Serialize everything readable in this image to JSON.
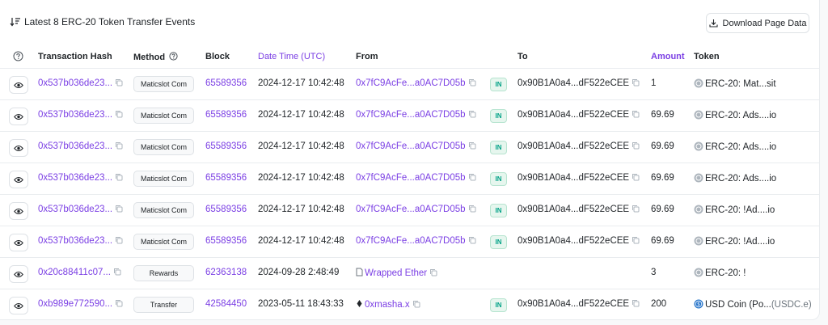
{
  "header": {
    "title": "Latest 8 ERC-20 Token Transfer Events",
    "download_label": "Download Page Data"
  },
  "columns": {
    "tx_hash": "Transaction Hash",
    "method": "Method",
    "block": "Block",
    "datetime": "Date Time (UTC)",
    "from": "From",
    "to": "To",
    "amount": "Amount",
    "token": "Token"
  },
  "rows": [
    {
      "hash": "0x537b036de23...",
      "method": "Maticslot Com",
      "block": "65589356",
      "time": "2024-12-17 10:42:48",
      "from": "0x7fC9AcFe...a0AC7D05b",
      "from_type": "address",
      "direction": "IN",
      "to": "0x90B1A0a4...dF522eCEE",
      "amount": "1",
      "token": "ERC-20: Mat...sit",
      "token_extra": "",
      "token_icon": "token-generic-icon"
    },
    {
      "hash": "0x537b036de23...",
      "method": "Maticslot Com",
      "block": "65589356",
      "time": "2024-12-17 10:42:48",
      "from": "0x7fC9AcFe...a0AC7D05b",
      "from_type": "address",
      "direction": "IN",
      "to": "0x90B1A0a4...dF522eCEE",
      "amount": "69.69",
      "token": "ERC-20: Ads....io",
      "token_extra": "",
      "token_icon": "token-generic-icon"
    },
    {
      "hash": "0x537b036de23...",
      "method": "Maticslot Com",
      "block": "65589356",
      "time": "2024-12-17 10:42:48",
      "from": "0x7fC9AcFe...a0AC7D05b",
      "from_type": "address",
      "direction": "IN",
      "to": "0x90B1A0a4...dF522eCEE",
      "amount": "69.69",
      "token": "ERC-20: Ads....io",
      "token_extra": "",
      "token_icon": "token-generic-icon"
    },
    {
      "hash": "0x537b036de23...",
      "method": "Maticslot Com",
      "block": "65589356",
      "time": "2024-12-17 10:42:48",
      "from": "0x7fC9AcFe...a0AC7D05b",
      "from_type": "address",
      "direction": "IN",
      "to": "0x90B1A0a4...dF522eCEE",
      "amount": "69.69",
      "token": "ERC-20: Ads....io",
      "token_extra": "",
      "token_icon": "token-generic-icon"
    },
    {
      "hash": "0x537b036de23...",
      "method": "Maticslot Com",
      "block": "65589356",
      "time": "2024-12-17 10:42:48",
      "from": "0x7fC9AcFe...a0AC7D05b",
      "from_type": "address",
      "direction": "IN",
      "to": "0x90B1A0a4...dF522eCEE",
      "amount": "69.69",
      "token": "ERC-20: !Ad....io",
      "token_extra": "",
      "token_icon": "token-generic-icon"
    },
    {
      "hash": "0x537b036de23...",
      "method": "Maticslot Com",
      "block": "65589356",
      "time": "2024-12-17 10:42:48",
      "from": "0x7fC9AcFe...a0AC7D05b",
      "from_type": "address",
      "direction": "IN",
      "to": "0x90B1A0a4...dF522eCEE",
      "amount": "69.69",
      "token": "ERC-20: !Ad....io",
      "token_extra": "",
      "token_icon": "token-generic-icon"
    },
    {
      "hash": "0x20c88411c07...",
      "method": "Rewards",
      "block": "62363138",
      "time": "2024-09-28 2:48:49",
      "from": "Wrapped Ether",
      "from_type": "contract",
      "direction": "",
      "to": "",
      "amount": "3",
      "token": "ERC-20: !",
      "token_extra": "",
      "token_icon": "token-generic-icon"
    },
    {
      "hash": "0xb989e772590...",
      "method": "Transfer",
      "block": "42584450",
      "time": "2023-05-11 18:43:33",
      "from": "0xmasha.x",
      "from_type": "ens",
      "direction": "IN",
      "to": "0x90B1A0a4...dF522eCEE",
      "amount": "200",
      "token": "USD Coin (Po...",
      "token_extra": "(USDC.e)",
      "token_icon": "usdc-icon"
    }
  ],
  "colors": {
    "link": "#7b3fe4",
    "in_badge_text": "#00a186",
    "in_badge_bg": "#e6f6ee",
    "usdc": "#2775ca"
  }
}
